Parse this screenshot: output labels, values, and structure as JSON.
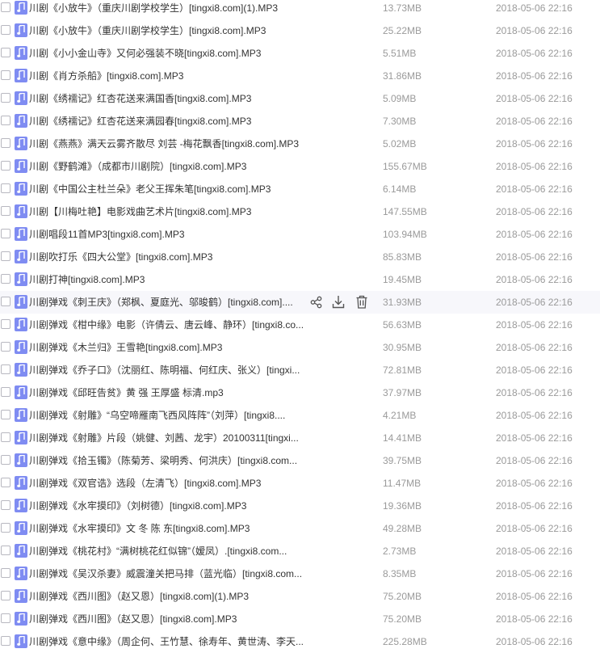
{
  "colors": {
    "row_hover_bg": "#f7f7fb",
    "file_icon_bg": "#7f8cf2",
    "name_text": "#333333",
    "meta_text": "#9a9a9a"
  },
  "row_actions": {
    "share_icon": "share-icon",
    "download_icon": "download-icon",
    "delete_icon": "trash-icon"
  },
  "files": [
    {
      "name": "川剧《小放牛》（重庆川剧学校学生）[tingxi8.com](1).MP3",
      "size": "13.73MB",
      "date": "2018-05-06 22:16"
    },
    {
      "name": "川剧《小放牛》（重庆川剧学校学生）[tingxi8.com].MP3",
      "size": "25.22MB",
      "date": "2018-05-06 22:16"
    },
    {
      "name": "川剧《小小金山寺》又何必强装不晓[tingxi8.com].MP3",
      "size": "5.51MB",
      "date": "2018-05-06 22:16"
    },
    {
      "name": "川剧《肖方杀船》[tingxi8.com].MP3",
      "size": "31.86MB",
      "date": "2018-05-06 22:16"
    },
    {
      "name": "川剧《绣襦记》红杏花送来满国香[tingxi8.com].MP3",
      "size": "5.09MB",
      "date": "2018-05-06 22:16"
    },
    {
      "name": "川剧《绣襦记》红杏花送来满园春[tingxi8.com].MP3",
      "size": "7.30MB",
      "date": "2018-05-06 22:16"
    },
    {
      "name": "川剧《燕燕》满天云雾齐散尽 刘芸 -梅花飘香[tingxi8.com].MP3",
      "size": "5.02MB",
      "date": "2018-05-06 22:16"
    },
    {
      "name": "川剧《野鹤滩》（成都市川剧院）[tingxi8.com].MP3",
      "size": "155.67MB",
      "date": "2018-05-06 22:16"
    },
    {
      "name": "川剧《中国公主杜兰朵》老父王挥朱笔[tingxi8.com].MP3",
      "size": "6.14MB",
      "date": "2018-05-06 22:16"
    },
    {
      "name": "川剧【川梅吐艳】电影戏曲艺术片[tingxi8.com].MP3",
      "size": "147.55MB",
      "date": "2018-05-06 22:16"
    },
    {
      "name": "川剧唱段11首MP3[tingxi8.com].MP3",
      "size": "103.94MB",
      "date": "2018-05-06 22:16"
    },
    {
      "name": "川剧吹打乐《四大公堂》[tingxi8.com].MP3",
      "size": "85.83MB",
      "date": "2018-05-06 22:16"
    },
    {
      "name": "川剧打神[tingxi8.com].MP3",
      "size": "19.45MB",
      "date": "2018-05-06 22:16"
    },
    {
      "name": "川剧弹戏《刺王庆》（郑枫、夏庭光、邬晙鹤）[tingxi8.com]....",
      "size": "31.93MB",
      "date": "2018-05-06 22:16",
      "hovered": true
    },
    {
      "name": "川剧弹戏《柑中缘》电影（许倩云、唐云峰、静环）[tingxi8.co...",
      "size": "56.63MB",
      "date": "2018-05-06 22:16"
    },
    {
      "name": "川剧弹戏《木兰归》王雪艳[tingxi8.com].MP3",
      "size": "30.95MB",
      "date": "2018-05-06 22:16"
    },
    {
      "name": "川剧弹戏《乔子口》（沈丽红、陈明福、何红庆、张义）[tingxi...",
      "size": "72.81MB",
      "date": "2018-05-06 22:16"
    },
    {
      "name": "川剧弹戏《邱旺告贫》黄 强 王厚盛 标清.mp3",
      "size": "37.97MB",
      "date": "2018-05-06 22:16"
    },
    {
      "name": "川剧弹戏《射雕》“乌空啼雁南飞西风阵阵”（刘萍）[tingxi8....",
      "size": "4.21MB",
      "date": "2018-05-06 22:16"
    },
    {
      "name": "川剧弹戏《射雕》片段（姚健、刘茜、龙宇）20100311[tingxi...",
      "size": "14.41MB",
      "date": "2018-05-06 22:16"
    },
    {
      "name": "川剧弹戏《拾玉镯》（陈菊芳、梁明秀、何洪庆）[tingxi8.com...",
      "size": "39.75MB",
      "date": "2018-05-06 22:16"
    },
    {
      "name": "川剧弹戏《双官诰》选段（左清飞）[tingxi8.com].MP3",
      "size": "11.47MB",
      "date": "2018-05-06 22:16"
    },
    {
      "name": "川剧弹戏《水牢摸印》（刘树德）[tingxi8.com].MP3",
      "size": "19.36MB",
      "date": "2018-05-06 22:16"
    },
    {
      "name": "川剧弹戏《水牢摸印》文 冬 陈 东[tingxi8.com].MP3",
      "size": "49.28MB",
      "date": "2018-05-06 22:16"
    },
    {
      "name": "川剧弹戏《桃花村》“满树桃花红似锦”（嫒凤）.[tingxi8.com...",
      "size": "2.73MB",
      "date": "2018-05-06 22:16"
    },
    {
      "name": "川剧弹戏《吴汉杀妻》威震潼关把马排（蓝光临）[tingxi8.com...",
      "size": "8.35MB",
      "date": "2018-05-06 22:16"
    },
    {
      "name": "川剧弹戏《西川图》（赵又恩）[tingxi8.com](1).MP3",
      "size": "75.20MB",
      "date": "2018-05-06 22:16"
    },
    {
      "name": "川剧弹戏《西川图》（赵又恩）[tingxi8.com].MP3",
      "size": "75.20MB",
      "date": "2018-05-06 22:16"
    },
    {
      "name": "川剧弹戏《意中缘》（周企何、王竹慧、徐寿年、黄世涛、李天...",
      "size": "225.28MB",
      "date": "2018-05-06 22:16"
    }
  ]
}
